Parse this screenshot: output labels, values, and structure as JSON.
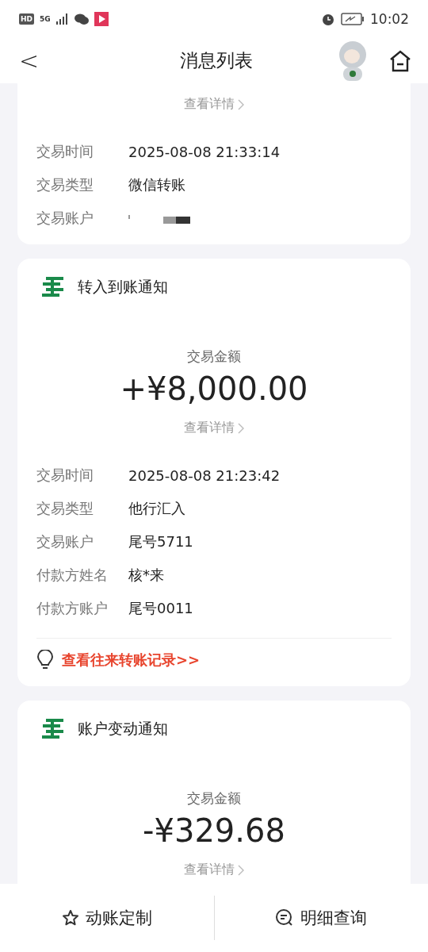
{
  "status_bar": {
    "hd": "HD",
    "network": "5G",
    "time": "10:02"
  },
  "header": {
    "back": "<",
    "title": "消息列表"
  },
  "cards": [
    {
      "details_link": "查看详情",
      "rows": [
        {
          "label": "交易时间",
          "value": "2025-08-08 21:33:14",
          "kind": "text"
        },
        {
          "label": "交易类型",
          "value": "微信转账",
          "kind": "text"
        },
        {
          "label": "交易账户",
          "kind": "redacted"
        }
      ]
    },
    {
      "title": "转入到账通知",
      "amount_label": "交易金额",
      "amount": "+¥8,000.00",
      "details_link": "查看详情",
      "rows": [
        {
          "label": "交易时间",
          "value": "2025-08-08 21:23:42",
          "kind": "text"
        },
        {
          "label": "交易类型",
          "value": "他行汇入",
          "kind": "text"
        },
        {
          "label": "交易账户",
          "value": "尾号5711",
          "kind": "text"
        },
        {
          "label": "付款方姓名",
          "value": "核*来",
          "kind": "text"
        },
        {
          "label": "付款方账户",
          "value": "尾号0011",
          "kind": "text"
        }
      ],
      "history_link": "查看往来转账记录>>"
    },
    {
      "title": "账户变动通知",
      "amount_label": "交易金额",
      "amount": "-¥329.68",
      "details_link": "查看详情"
    }
  ],
  "bottom_bar": [
    {
      "label": "动账定制",
      "kind": "star"
    },
    {
      "label": "明细查询",
      "kind": "search"
    }
  ]
}
